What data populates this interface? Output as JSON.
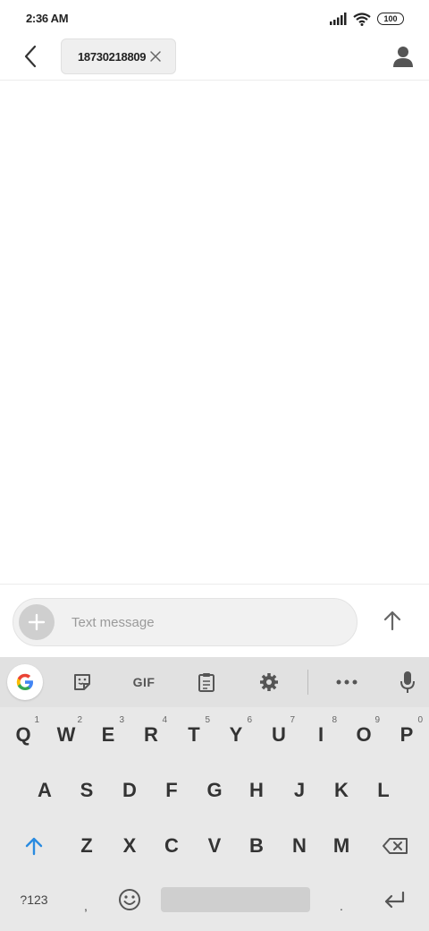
{
  "status_bar": {
    "time": "2:36 AM",
    "battery": "100",
    "icons": [
      "signal-icon",
      "wifi-icon",
      "battery-icon"
    ]
  },
  "header": {
    "recipient": "18730218809",
    "icons": [
      "back-arrow-icon",
      "close-icon",
      "contact-icon"
    ]
  },
  "compose": {
    "placeholder": "Text message",
    "icons": [
      "plus-icon",
      "send-arrow-icon"
    ]
  },
  "keyboard": {
    "toolbar": {
      "gif_label": "GIF",
      "icons": [
        "google-icon",
        "sticker-icon",
        "clipboard-icon",
        "gear-icon",
        "more-icon",
        "mic-icon"
      ]
    },
    "row1": [
      {
        "label": "Q",
        "hint": "1"
      },
      {
        "label": "W",
        "hint": "2"
      },
      {
        "label": "E",
        "hint": "3"
      },
      {
        "label": "R",
        "hint": "4"
      },
      {
        "label": "T",
        "hint": "5"
      },
      {
        "label": "Y",
        "hint": "6"
      },
      {
        "label": "U",
        "hint": "7"
      },
      {
        "label": "I",
        "hint": "8"
      },
      {
        "label": "O",
        "hint": "9"
      },
      {
        "label": "P",
        "hint": "0"
      }
    ],
    "row2": [
      "A",
      "S",
      "D",
      "F",
      "G",
      "H",
      "J",
      "K",
      "L"
    ],
    "row3": [
      "Z",
      "X",
      "C",
      "V",
      "B",
      "N",
      "M"
    ],
    "row4": {
      "symbols": "?123",
      "comma": ",",
      "period": "."
    },
    "accent_color": "#2a8be0"
  }
}
